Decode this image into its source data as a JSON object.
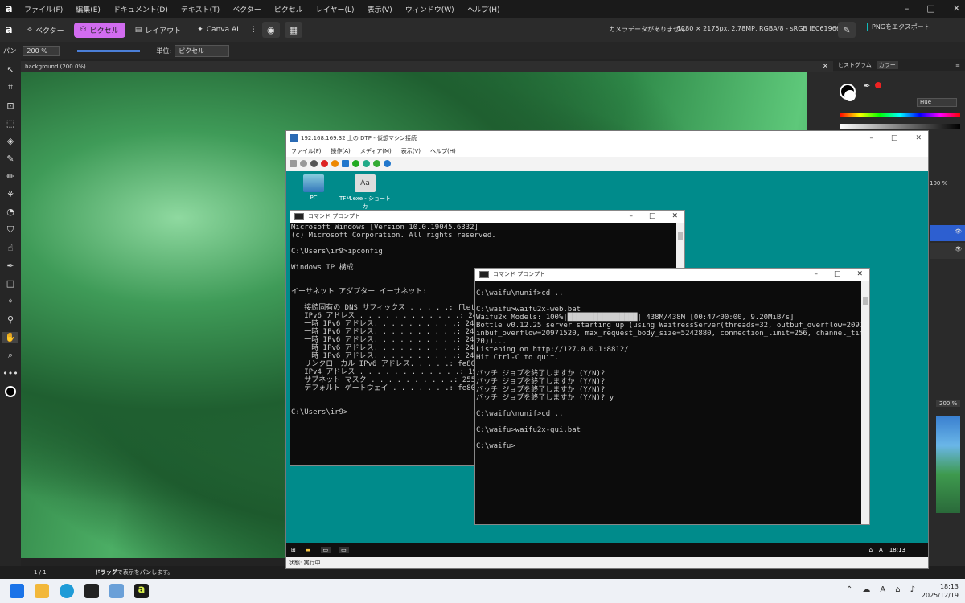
{
  "menubar": {
    "items": [
      "ファイル(F)",
      "編集(E)",
      "ドキュメント(D)",
      "テキスト(T)",
      "ベクター",
      "ピクセル",
      "レイヤー(L)",
      "表示(V)",
      "ウィンドウ(W)",
      "ヘルプ(H)"
    ]
  },
  "toolbar": {
    "personas": [
      "ベクター",
      "ピクセル",
      "レイアウト",
      "Canva AI"
    ],
    "camera": "カメラデータがありません",
    "doc_info": "1280 × 2175px, 2.78MP, RGBA/8 - sRGB IEC61966-2.1",
    "export": "PNGをエクスポート"
  },
  "context": {
    "zoom": "200 %",
    "unit_label": "単位:",
    "unit_value": "ピクセル",
    "left_label": "パン"
  },
  "document": {
    "tab": "background (200.0%)"
  },
  "right_panel": {
    "tab1": "ヒストグラム",
    "tab2": "カラー",
    "mode": "Hue",
    "pct": "100 %",
    "zoom": "200 %"
  },
  "status": {
    "page": "1 / 1",
    "drag": "ドラッグ",
    "hint": "で表示をパンします。"
  },
  "vm": {
    "title": "192.168.169.32 上の DTP - 仮想マシン接続",
    "menu": [
      "ファイル(F)",
      "操作(A)",
      "メディア(M)",
      "表示(V)",
      "ヘルプ(H)"
    ],
    "icons": [
      {
        "label": "PC",
        "icon": "pc-icon"
      },
      {
        "label": "TFM.exe - ショートカ",
        "icon": "font-icon"
      }
    ],
    "taskbar_time": "18:13",
    "status": "状態: 実行中"
  },
  "cmd1": {
    "title": "コマンド プロンプト",
    "lines": [
      "Microsoft Windows [Version 10.0.19045.6332]",
      "(c) Microsoft Corporation. All rights reserved.",
      "",
      "C:\\Users\\ir9>ipconfig",
      "",
      "Windows IP 構成",
      "",
      "",
      "イーサネット アダプター イーサネット:",
      "",
      "   接続固有の DNS サフィックス . . . . .: flet",
      "   IPv6 アドレス . . . . . . . . . . . .: 2405",
      "   一時 IPv6 アドレス. . . . . . . . . .: 2405",
      "   一時 IPv6 アドレス. . . . . . . . . .: 2405",
      "   一時 IPv6 アドレス. . . . . . . . . .: 2405",
      "   一時 IPv6 アドレス. . . . . . . . . .: 2405",
      "   一時 IPv6 アドレス. . . . . . . . . .: 2405",
      "   リンクローカル IPv6 アドレス. . . . .: fe80",
      "   IPv4 アドレス . . . . . . . . . . . .: 192.",
      "   サブネット マスク . . . . . . . . . .: 255.",
      "   デフォルト ゲートウェイ . . . . . . .: fe80",
      "                                          192.",
      "",
      "C:\\Users\\ir9>"
    ]
  },
  "cmd2": {
    "title": "コマンド プロンプト",
    "lines": [
      "",
      "C:\\waifu\\nunif>cd ..",
      "",
      "C:\\waifu>waifu2x-web.bat",
      "Waifu2x Models: 100%|████████████████| 438M/438M [00:47<00:00, 9.20MiB/s]",
      "Bottle v0.12.25 server starting up (using WaitressServer(threads=32, outbuf_overflow=20971520,",
      "inbuf_overflow=20971520, max_request_body_size=5242880, connection_limit=256, channel_timeout=1",
      "20))...",
      "Listening on http://127.0.0.1:8812/",
      "Hit Ctrl-C to quit.",
      "",
      "バッチ ジョブを終了しますか (Y/N)?",
      "バッチ ジョブを終了しますか (Y/N)?",
      "バッチ ジョブを終了しますか (Y/N)?",
      "バッチ ジョブを終了しますか (Y/N)? y",
      "",
      "C:\\waifu\\nunif>cd ..",
      "",
      "C:\\waifu>waifu2x-gui.bat",
      "",
      "C:\\waifu>"
    ]
  },
  "host": {
    "time": "18:13",
    "date": "2025/12/19"
  }
}
